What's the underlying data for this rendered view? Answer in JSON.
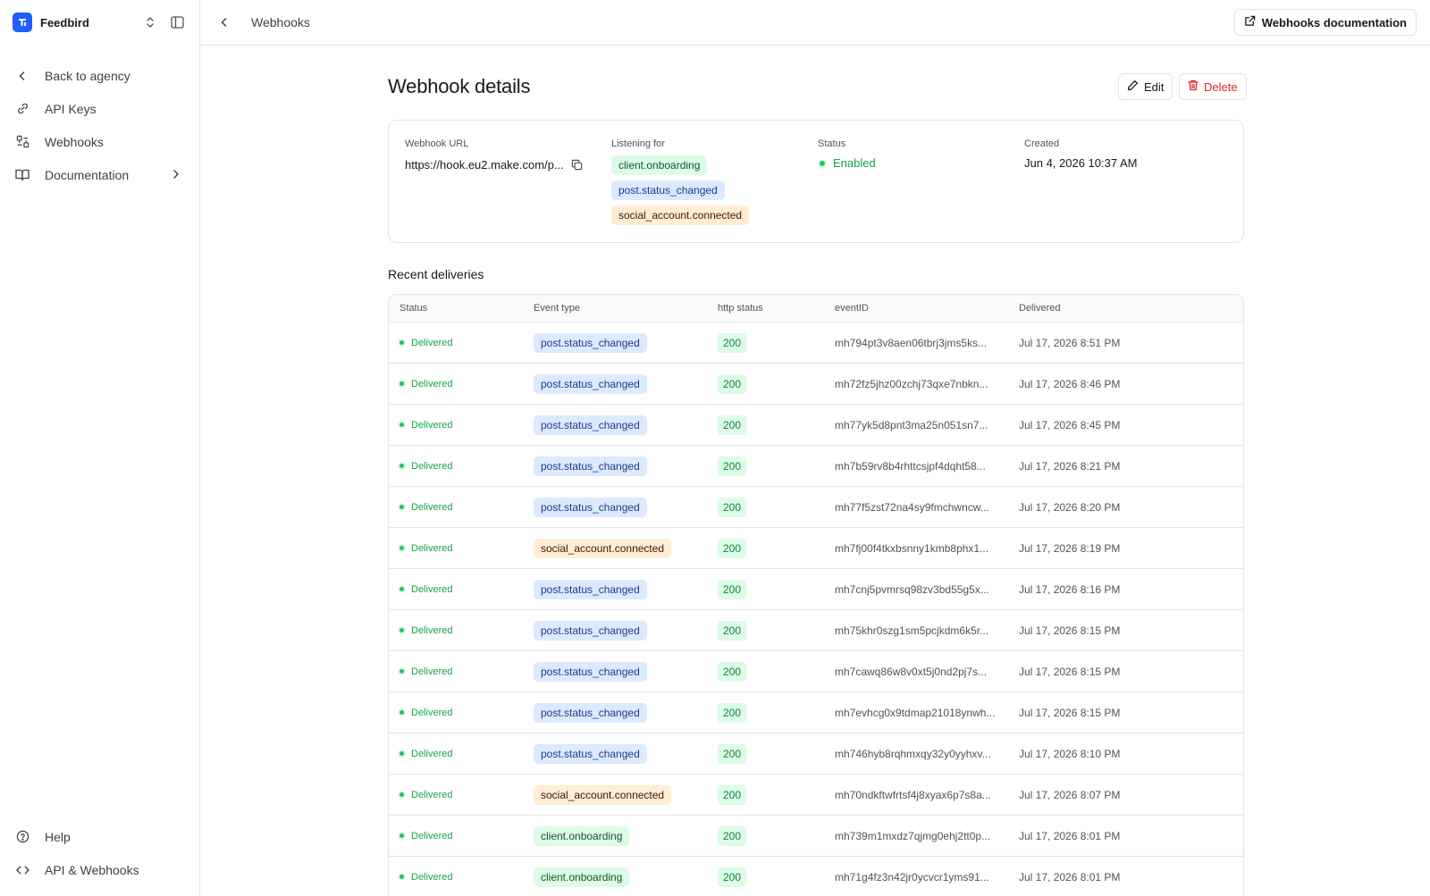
{
  "app": {
    "name": "Feedbird"
  },
  "sidebar": {
    "items": [
      {
        "label": "Back to agency",
        "icon": "chevron-left-icon"
      },
      {
        "label": "API Keys",
        "icon": "link-icon"
      },
      {
        "label": "Webhooks",
        "icon": "webhook-icon"
      },
      {
        "label": "Documentation",
        "icon": "book-open-icon"
      }
    ],
    "bottom": [
      {
        "label": "Help",
        "icon": "help-circle-icon"
      },
      {
        "label": "API & Webhooks",
        "icon": "code-icon"
      }
    ]
  },
  "topbar": {
    "title": "Webhooks",
    "docs_label": "Webhooks documentation"
  },
  "page": {
    "title": "Webhook details",
    "edit_label": "Edit",
    "delete_label": "Delete"
  },
  "details": {
    "url_label": "Webhook URL",
    "url_value": "https://hook.eu2.make.com/p...",
    "listening_label": "Listening for",
    "events": [
      "client.onboarding",
      "post.status_changed",
      "social_account.connected"
    ],
    "status_label": "Status",
    "status_value": "Enabled",
    "created_label": "Created",
    "created_value": "Jun 4, 2026 10:37 AM"
  },
  "deliveries": {
    "title": "Recent deliveries",
    "columns": [
      "Status",
      "Event type",
      "http status",
      "eventID",
      "Delivered"
    ],
    "rows": [
      {
        "status": "Delivered",
        "event": "post.status_changed",
        "http": "200",
        "id": "mh794pt3v8aen06tbrj3jms5ks...",
        "date": "Jul 17, 2026 8:51 PM"
      },
      {
        "status": "Delivered",
        "event": "post.status_changed",
        "http": "200",
        "id": "mh72fz5jhz00zchj73qxe7nbkn...",
        "date": "Jul 17, 2026 8:46 PM"
      },
      {
        "status": "Delivered",
        "event": "post.status_changed",
        "http": "200",
        "id": "mh77yk5d8pnt3ma25n051sn7...",
        "date": "Jul 17, 2026 8:45 PM"
      },
      {
        "status": "Delivered",
        "event": "post.status_changed",
        "http": "200",
        "id": "mh7b59rv8b4rhttcsjpf4dqht58...",
        "date": "Jul 17, 2026 8:21 PM"
      },
      {
        "status": "Delivered",
        "event": "post.status_changed",
        "http": "200",
        "id": "mh77f5zst72na4sy9fmchwncw...",
        "date": "Jul 17, 2026 8:20 PM"
      },
      {
        "status": "Delivered",
        "event": "social_account.connected",
        "http": "200",
        "id": "mh7fj00f4tkxbsnny1kmb8phx1...",
        "date": "Jul 17, 2026 8:19 PM"
      },
      {
        "status": "Delivered",
        "event": "post.status_changed",
        "http": "200",
        "id": "mh7cnj5pvmrsq98zv3bd55g5x...",
        "date": "Jul 17, 2026 8:16 PM"
      },
      {
        "status": "Delivered",
        "event": "post.status_changed",
        "http": "200",
        "id": "mh75khr0szg1sm5pcjkdm6k5r...",
        "date": "Jul 17, 2026 8:15 PM"
      },
      {
        "status": "Delivered",
        "event": "post.status_changed",
        "http": "200",
        "id": "mh7cawq86w8v0xt5j0nd2pj7s...",
        "date": "Jul 17, 2026 8:15 PM"
      },
      {
        "status": "Delivered",
        "event": "post.status_changed",
        "http": "200",
        "id": "mh7evhcg0x9tdmap21018ynwh...",
        "date": "Jul 17, 2026 8:15 PM"
      },
      {
        "status": "Delivered",
        "event": "post.status_changed",
        "http": "200",
        "id": "mh746hyb8rqhmxqy32y0yyhxv...",
        "date": "Jul 17, 2026 8:10 PM"
      },
      {
        "status": "Delivered",
        "event": "social_account.connected",
        "http": "200",
        "id": "mh70ndkftwfrtsf4j8xyax6p7s8a...",
        "date": "Jul 17, 2026 8:07 PM"
      },
      {
        "status": "Delivered",
        "event": "client.onboarding",
        "http": "200",
        "id": "mh739m1mxdz7qjmg0ehj2tt0p...",
        "date": "Jul 17, 2026 8:01 PM"
      },
      {
        "status": "Delivered",
        "event": "client.onboarding",
        "http": "200",
        "id": "mh71g4fz3n42jr0ycvcr1yms91...",
        "date": "Jul 17, 2026 8:01 PM"
      }
    ]
  },
  "colors": {
    "brand": "#1f5eff",
    "success": "#16a34a",
    "danger": "#dc2626",
    "tag_client_onboarding": "#dcfce7",
    "tag_post_status_changed": "#dbeafe",
    "tag_social_account_connected": "#ffedd5"
  }
}
